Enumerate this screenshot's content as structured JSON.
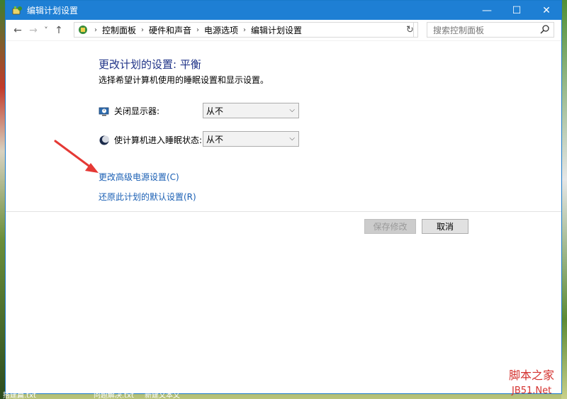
{
  "window": {
    "title": "编辑计划设置",
    "controls": {
      "minimize": "—",
      "maximize": "☐",
      "close": "✕"
    }
  },
  "addressbar": {
    "back": "←",
    "forward": "→",
    "recent": "˅",
    "up": "↑",
    "breadcrumbs": [
      "控制面板",
      "硬件和声音",
      "电源选项",
      "编辑计划设置"
    ],
    "dropdown": "˅",
    "refresh": "↻",
    "search_placeholder": "搜索控制面板"
  },
  "main": {
    "heading": "更改计划的设置: 平衡",
    "subtitle": "选择希望计算机使用的睡眠设置和显示设置。",
    "settings": [
      {
        "label": "关闭显示器:",
        "value": "从不",
        "icon": "display-timer-icon"
      },
      {
        "label": "使计算机进入睡眠状态:",
        "value": "从不",
        "icon": "sleep-moon-icon"
      }
    ],
    "links": {
      "advanced": "更改高级电源设置(C)",
      "restore": "还原此计划的默认设置(R)"
    },
    "buttons": {
      "save": "保存修改",
      "cancel": "取消"
    }
  },
  "annotation": {
    "arrow_color": "#e53935"
  },
  "taskbar": {
    "item1": "搭建篇.txt",
    "item2": "问题解决.txt",
    "item3": "新建文本文"
  },
  "watermark": {
    "line1": "脚本之家",
    "line2": "JB51.Net"
  },
  "colors": {
    "titlebar": "#1e7fd4",
    "heading": "#1e3287",
    "link": "#1a5fb4"
  }
}
